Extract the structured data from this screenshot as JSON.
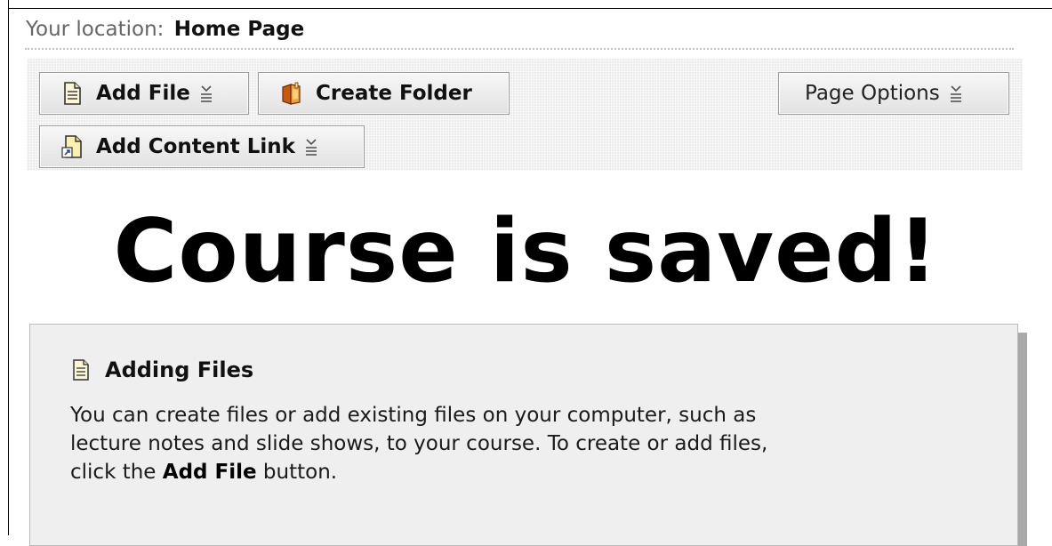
{
  "breadcrumb": {
    "prefix": "Your location:",
    "current": "Home Page"
  },
  "toolbar": {
    "add_file": {
      "label": "Add File",
      "icon": "document-icon"
    },
    "create_folder": {
      "label": "Create Folder",
      "icon": "folder-icon"
    },
    "page_options": {
      "label": "Page Options"
    },
    "add_content_link": {
      "label": "Add Content Link",
      "icon": "document-link-icon"
    },
    "menu_indicator_icon": "menu-chevron-icon"
  },
  "headline": "Course is saved!",
  "info": {
    "title": "Adding Files",
    "icon": "document-icon",
    "text_before": "You can create files or add existing files on your computer, such as lecture notes and slide shows, to your course. To create or add files, click the ",
    "text_bold": "Add File",
    "text_after": " button."
  },
  "colors": {
    "toolbar_bg": "#ececec",
    "button_border": "#9c9c9c",
    "info_bg": "#efefef",
    "info_shadow": "#a9a9a9",
    "icon_folder": "#e07a1a"
  }
}
